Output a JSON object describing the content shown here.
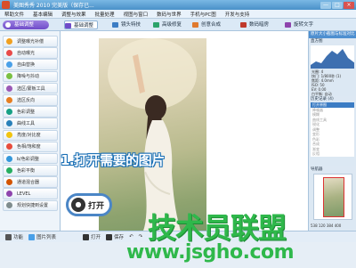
{
  "window": {
    "title": "美图秀秀  2010  完美版（保存已...",
    "minimize_label": "—",
    "restore_label": "□",
    "close_label": "×"
  },
  "menu": [
    "帮助文件",
    "基本编辑",
    "调整与效果",
    "批量处理",
    "视图与窗口",
    "数码与世界",
    "手机与PC图",
    "开发与支持"
  ],
  "modebar": {
    "active_mode": "基础调整",
    "tools": [
      {
        "label": "基础调整",
        "icon": "fx-icon",
        "color": "#6f4cc9"
      },
      {
        "label": "镜头特技",
        "icon": "lens-icon",
        "color": "#3b7cc4"
      },
      {
        "label": "高级修复",
        "icon": "heal-icon",
        "color": "#2ca36a"
      },
      {
        "label": "创意合成",
        "icon": "compose-icon",
        "color": "#e07a2e"
      },
      {
        "label": "数码暗房",
        "icon": "darkroom-icon",
        "color": "#c0392b"
      },
      {
        "label": "旋转文字",
        "icon": "text-icon",
        "color": "#8e44ad"
      }
    ]
  },
  "left_panel": {
    "items": [
      {
        "label": "调整曝光补偿",
        "color": "#f0a020"
      },
      {
        "label": "自动曝光",
        "color": "#e84a4a"
      },
      {
        "label": "自由替换",
        "color": "#4aa0e8"
      },
      {
        "label": "降噪与抖动",
        "color": "#7bc043"
      },
      {
        "label": "选区/蒙板工具",
        "color": "#9b59b6"
      },
      {
        "label": "选区反向",
        "color": "#e67e22"
      },
      {
        "label": "色彩调整",
        "color": "#16a085"
      },
      {
        "label": "曲线工具",
        "color": "#2980b9"
      },
      {
        "label": "亮度/对比度",
        "color": "#f1c40f"
      },
      {
        "label": "色相/饱和度",
        "color": "#e74c3c"
      },
      {
        "label": "b/色彩调整",
        "color": "#3498db"
      },
      {
        "label": "色彩平衡",
        "color": "#27ae60"
      },
      {
        "label": "通道混合器",
        "color": "#d35400"
      },
      {
        "label": "LEVEL",
        "color": "#8e44ad"
      },
      {
        "label": "规划快捷到设置",
        "color": "#7f8c8d"
      }
    ]
  },
  "canvas": {
    "callout": "1.打开需要的图片",
    "open_button_label": "打开"
  },
  "right_panel": {
    "header": "原片大小截图与标准对比",
    "histogram_label": "直方图",
    "exif": [
      "光圈: 4",
      "快门: 1/800秒 (1)",
      "焦距: 4.0mm",
      "ISO: 50",
      "EV: 0.00",
      "白平衡: 自动"
    ],
    "history_header": "历史记录 (4)",
    "history": [
      "打开原图",
      "降噪器",
      "模糊",
      "曲线工具",
      "锐化",
      "调整",
      "变形",
      "色彩",
      "合成",
      "渐变",
      "反相",
      "滤镜",
      "裁剪",
      "边框",
      "保存"
    ],
    "navigator_label": "导航器",
    "zoom": "538  120  384  400"
  },
  "bottombar": [
    {
      "label": "功能",
      "color": "#555"
    },
    {
      "label": "图片列表",
      "color": "#4aa0e8"
    },
    {
      "label": "打开",
      "color": "#333"
    },
    {
      "label": "保存",
      "color": "#333"
    }
  ],
  "watermark": {
    "main": "技术员联盟",
    "url": "www.jsgho.com"
  }
}
